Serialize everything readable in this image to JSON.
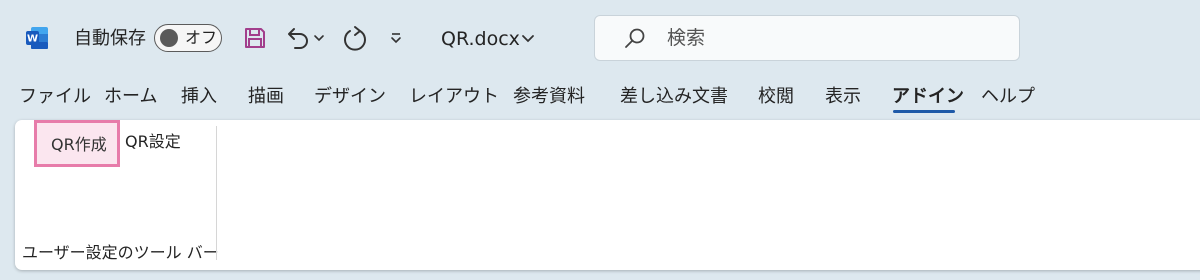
{
  "titlebar": {
    "app_icon": "word-icon",
    "autosave_label": "自動保存",
    "autosave_state": "オフ",
    "doc_title": "QR.docx",
    "search_placeholder": "検索"
  },
  "qat": {
    "icons": [
      "save-icon",
      "undo-icon",
      "chevron-down-icon",
      "redo-icon",
      "customize-qat-icon"
    ]
  },
  "tabs": [
    {
      "label": "ファイル"
    },
    {
      "label": "ホーム"
    },
    {
      "label": "挿入"
    },
    {
      "label": "描画"
    },
    {
      "label": "デザイン"
    },
    {
      "label": "レイアウト"
    },
    {
      "label": "参考資料"
    },
    {
      "label": "差し込み文書"
    },
    {
      "label": "校閲"
    },
    {
      "label": "表示"
    },
    {
      "label": "アドイン",
      "active": true
    },
    {
      "label": "ヘルプ"
    }
  ],
  "ribbon": {
    "buttons": [
      {
        "label": "QR作成"
      },
      {
        "label": "QR設定"
      }
    ],
    "group_label": "ユーザー設定のツール バー"
  },
  "colors": {
    "titlebar_bg": "#dde8ef",
    "word_blue": "#185abd",
    "save_purple": "#a23e8c",
    "highlight_border": "#e77caa",
    "highlight_fill": "#fbe6ef",
    "active_tab_underline": "#1f5aa8"
  }
}
